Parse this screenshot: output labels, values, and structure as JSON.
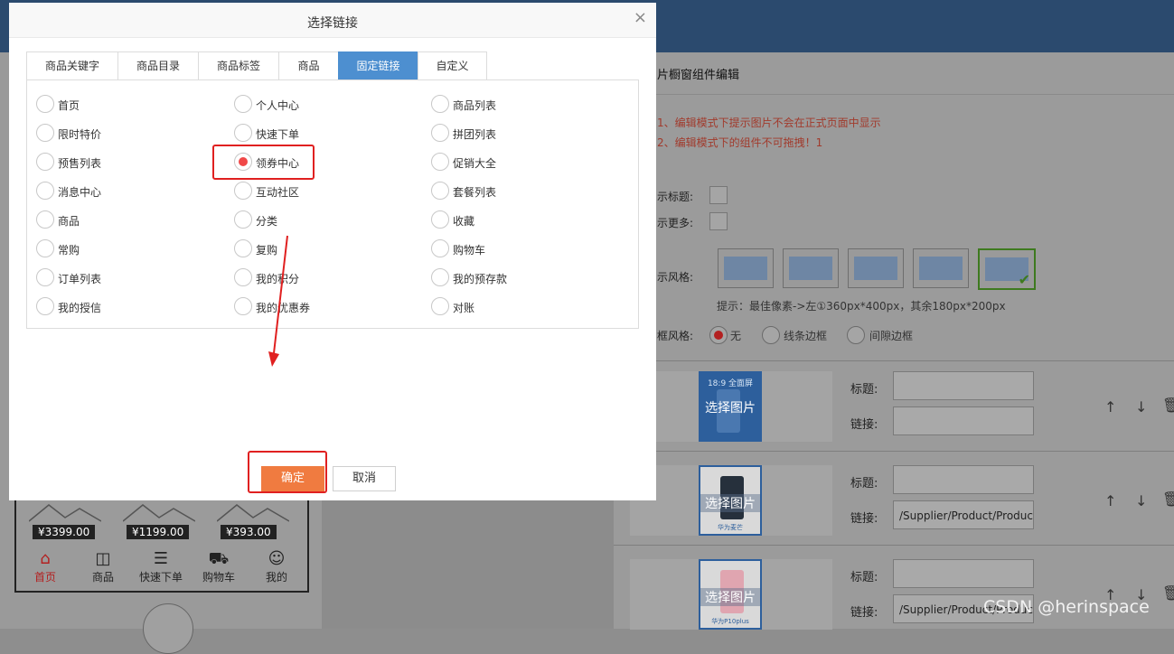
{
  "modal": {
    "title": "选择链接",
    "close": "×",
    "tabs": [
      "商品关键字",
      "商品目录",
      "商品标签",
      "商品",
      "固定链接",
      "自定义"
    ],
    "active_tab": "固定链接",
    "options": [
      [
        "首页",
        "个人中心",
        "商品列表"
      ],
      [
        "限时特价",
        "快速下单",
        "拼团列表"
      ],
      [
        "预售列表",
        "领券中心",
        "促销大全"
      ],
      [
        "消息中心",
        "互动社区",
        "套餐列表"
      ],
      [
        "商品",
        "分类",
        "收藏"
      ],
      [
        "常购",
        "复购",
        "购物车"
      ],
      [
        "订单列表",
        "我的积分",
        "我的预存款"
      ],
      [
        "我的授信",
        "我的优惠券",
        "对账"
      ]
    ],
    "selected_option": "领券中心",
    "confirm_label": "确定",
    "cancel_label": "取消"
  },
  "editor": {
    "title": "片橱窗组件编辑",
    "tips": [
      "1、编辑模式下提示图片不会在正式页面中显示",
      "2、编辑模式下的组件不可拖拽！1"
    ],
    "show_title_label": "示标题:",
    "show_more_label": "示更多:",
    "style_label": "示风格:",
    "hint": "提示：最佳像素->左①360px*400px，其余180px*200px",
    "border_label": "框风格:",
    "border_options": [
      "无",
      "线条边框",
      "间隙边框"
    ],
    "items": [
      {
        "image_label": "选择图片",
        "title_label": "标题:",
        "link_label": "链接:",
        "title_value": "",
        "link_value": ""
      },
      {
        "image_label": "选择图片",
        "title_label": "标题:",
        "link_label": "链接:",
        "title_value": "",
        "link_value": "/Supplier/Product/Product.a"
      },
      {
        "image_label": "选择图片",
        "title_label": "标题:",
        "link_label": "链接:",
        "title_value": "",
        "link_value": "/Supplier/Product/Product.a"
      }
    ],
    "phone_banner_text": "18:9 全面屏",
    "phone_caption_2": "华为麦芒",
    "phone_caption_3": "华为P10plus"
  },
  "preview": {
    "prices": [
      "¥3399.00",
      "¥1199.00",
      "¥393.00"
    ],
    "nav": [
      "首页",
      "商品",
      "快速下单",
      "购物车",
      "我的"
    ]
  },
  "watermark": "CSDN @herinspace",
  "colors": {
    "active_tab": "#4d8fd0",
    "confirm": "#f07b40",
    "radio_selected": "#f04848",
    "highlight": "#e02020"
  }
}
